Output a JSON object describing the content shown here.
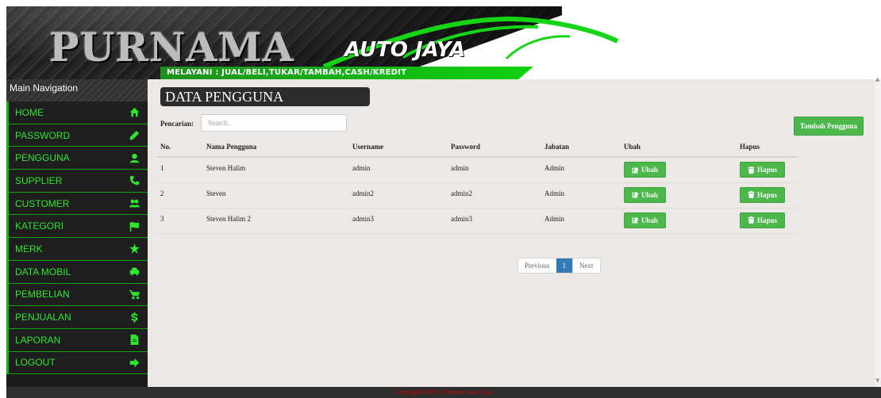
{
  "header": {
    "brand_main": "PURNAMA",
    "brand_sub": "AUTO JAYA",
    "tagline": "MELAYANI : JUAL/BELI,TUKAR/TAMBAH,CASH/KREDIT"
  },
  "sidebar": {
    "title": "Main Navigation",
    "items": [
      {
        "label": "HOME",
        "icon": "home-icon"
      },
      {
        "label": "PASSWORD",
        "icon": "pencil-icon"
      },
      {
        "label": "PENGGUNA",
        "icon": "user-icon"
      },
      {
        "label": "SUPPLIER",
        "icon": "phone-icon"
      },
      {
        "label": "CUSTOMER",
        "icon": "users-icon"
      },
      {
        "label": "KATEGORI",
        "icon": "flag-icon"
      },
      {
        "label": "MERK",
        "icon": "star-icon"
      },
      {
        "label": "DATA MOBIL",
        "icon": "car-icon"
      },
      {
        "label": "PEMBELIAN",
        "icon": "cart-icon"
      },
      {
        "label": "PENJUALAN",
        "icon": "dollar-icon"
      },
      {
        "label": "LAPORAN",
        "icon": "file-icon"
      },
      {
        "label": "LOGOUT",
        "icon": "sign-out-icon"
      }
    ]
  },
  "main": {
    "title": "DATA PENGGUNA",
    "search_label": "Pencarian:",
    "search_placeholder": "Search..",
    "search_value": "",
    "add_button": "Tambah Pengguna",
    "table": {
      "columns": [
        "No.",
        "Nama Pengguna",
        "Username",
        "Password",
        "Jabatan",
        "Ubah",
        "Hapus"
      ],
      "rows": [
        {
          "no": "1",
          "nama": "Steven Halim",
          "username": "admin",
          "password": "admin",
          "jabatan": "Admin"
        },
        {
          "no": "2",
          "nama": "Steven",
          "username": "admin2",
          "password": "admin2",
          "jabatan": "Admin"
        },
        {
          "no": "3",
          "nama": "Steven Halim 2",
          "username": "admin3",
          "password": "admin3",
          "jabatan": "Admin"
        }
      ],
      "edit_label": "Ubah",
      "delete_label": "Hapus"
    },
    "pagination": {
      "previous": "Previous",
      "current": "1",
      "next": "Next"
    }
  },
  "footer": {
    "text": "Copyright 2019 © Purnama Auto Jaya"
  },
  "colors": {
    "accent_green": "#2ee62e",
    "button_green": "#4cb84c",
    "footer_text": "#d40000",
    "page_active": "#337ab7"
  }
}
